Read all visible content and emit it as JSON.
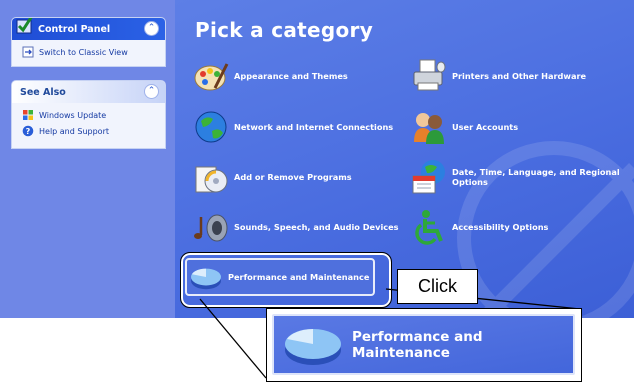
{
  "left_pane": {
    "control_panel": {
      "title": "Control Panel",
      "items": [
        {
          "label": "Switch to Classic View",
          "icon": "switch-view-icon"
        }
      ]
    },
    "see_also": {
      "title": "See Also",
      "items": [
        {
          "label": "Windows Update",
          "icon": "windows-update-icon"
        },
        {
          "label": "Help and Support",
          "icon": "help-icon"
        }
      ]
    }
  },
  "main": {
    "title": "Pick a category",
    "categories": [
      {
        "label": "Appearance and Themes",
        "icon": "appearance-themes-icon"
      },
      {
        "label": "Printers and Other Hardware",
        "icon": "printer-icon"
      },
      {
        "label": "Network and Internet Connections",
        "icon": "network-globe-icon"
      },
      {
        "label": "User Accounts",
        "icon": "user-accounts-icon"
      },
      {
        "label": "Add or Remove Programs",
        "icon": "add-remove-programs-icon"
      },
      {
        "label": "Date, Time, Language, and Regional Options",
        "icon": "date-time-globe-icon"
      },
      {
        "label": "Sounds, Speech, and Audio Devices",
        "icon": "sound-speaker-icon"
      },
      {
        "label": "Accessibility Options",
        "icon": "accessibility-icon"
      },
      {
        "label": "Performance and Maintenance",
        "icon": "pie-chart-icon"
      }
    ]
  },
  "callout": {
    "click_label": "Click",
    "zoom_label": "Performance and Maintenance"
  },
  "colors": {
    "pane_blue": "#4a6de0",
    "left_blue": "#6f87e6",
    "header_blue": "#2b62e6",
    "link_blue": "#153aa3"
  }
}
